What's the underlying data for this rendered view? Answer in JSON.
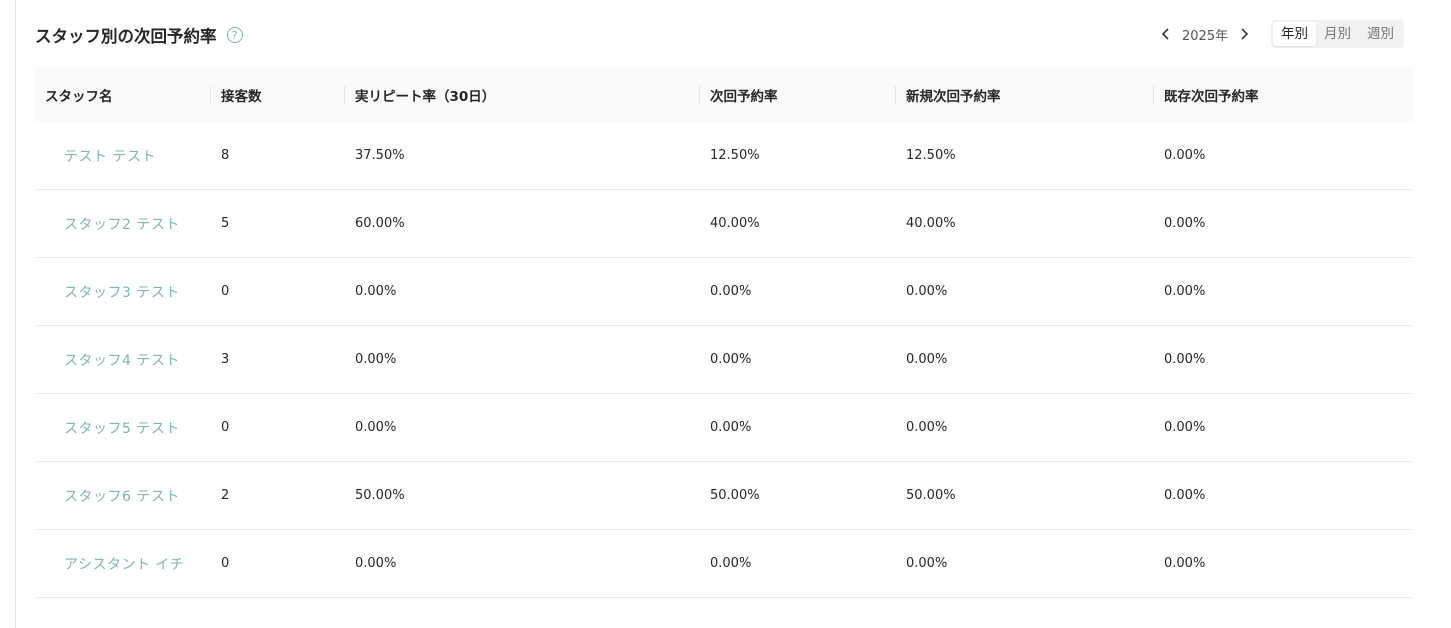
{
  "header": {
    "title": "スタッフ別の次回予約率",
    "help_icon": "question-circle-icon",
    "prev_icon": "chevron-left-icon",
    "next_icon": "chevron-right-icon",
    "year": "2025年",
    "period_tabs": [
      {
        "label": "年別",
        "active": true
      },
      {
        "label": "月別",
        "active": false
      },
      {
        "label": "週別",
        "active": false
      }
    ]
  },
  "colors": {
    "link": "#79b6bd",
    "header_bg": "#fafafa"
  },
  "table": {
    "columns": [
      "スタッフ名",
      "接客数",
      "実リピート率（30日）",
      "次回予約率",
      "新規次回予約率",
      "既存次回予約率"
    ],
    "rows": [
      {
        "name": "テスト テスト",
        "visits": "8",
        "repeat": "37.50%",
        "next": "12.50%",
        "new_next": "12.50%",
        "existing_next": "0.00%"
      },
      {
        "name": "スタッフ2 テスト",
        "visits": "5",
        "repeat": "60.00%",
        "next": "40.00%",
        "new_next": "40.00%",
        "existing_next": "0.00%"
      },
      {
        "name": "スタッフ3 テスト",
        "visits": "0",
        "repeat": "0.00%",
        "next": "0.00%",
        "new_next": "0.00%",
        "existing_next": "0.00%"
      },
      {
        "name": "スタッフ4 テスト",
        "visits": "3",
        "repeat": "0.00%",
        "next": "0.00%",
        "new_next": "0.00%",
        "existing_next": "0.00%"
      },
      {
        "name": "スタッフ5 テスト",
        "visits": "0",
        "repeat": "0.00%",
        "next": "0.00%",
        "new_next": "0.00%",
        "existing_next": "0.00%"
      },
      {
        "name": "スタッフ6 テスト",
        "visits": "2",
        "repeat": "50.00%",
        "next": "50.00%",
        "new_next": "50.00%",
        "existing_next": "0.00%"
      },
      {
        "name": "アシスタント イチ",
        "visits": "0",
        "repeat": "0.00%",
        "next": "0.00%",
        "new_next": "0.00%",
        "existing_next": "0.00%"
      }
    ]
  }
}
